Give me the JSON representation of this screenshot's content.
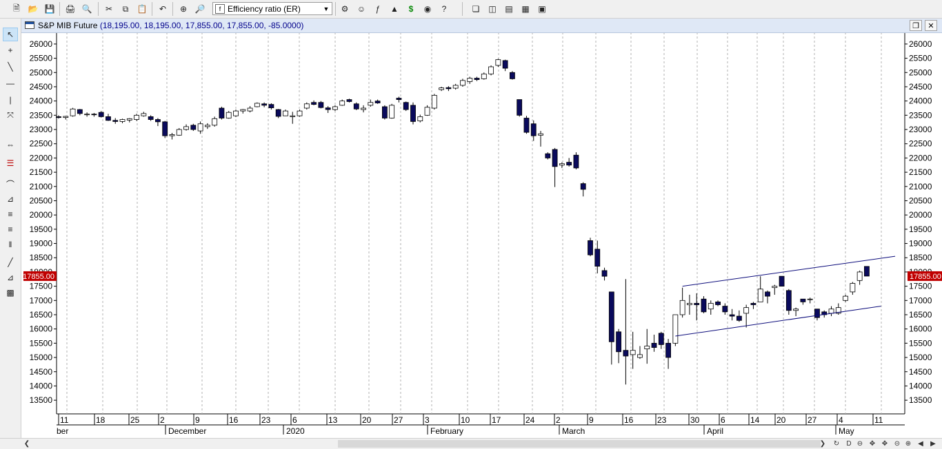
{
  "toolbar": {
    "indicator_dropdown": "Efficiency ratio (ER)"
  },
  "window": {
    "symbol": "S&P MIB Future",
    "ohlc": "(18,195.00, 18,195.00, 17,855.00, 17,855.00, -85.0000)"
  },
  "price_axis": {
    "labels": [
      "26000",
      "25500",
      "25000",
      "24500",
      "24000",
      "23500",
      "23000",
      "22500",
      "22000",
      "21500",
      "21000",
      "20500",
      "20000",
      "19500",
      "19000",
      "18500",
      "18000",
      "17500",
      "17000",
      "16500",
      "16000",
      "15500",
      "15000",
      "14500",
      "14000",
      "13500"
    ],
    "last_price_label": "17855.00",
    "last_price_color": "#c00000"
  },
  "time_axis": {
    "day_labels": [
      "11",
      "18",
      "25",
      "2",
      "9",
      "16",
      "23",
      "6",
      "13",
      "20",
      "27",
      "3",
      "10",
      "17",
      "24",
      "2",
      "9",
      "16",
      "23",
      "30",
      "6",
      "14",
      "20",
      "27",
      "4",
      "11"
    ],
    "month_labels": [
      "ber",
      "December",
      "2020",
      "February",
      "March",
      "April",
      "May"
    ]
  },
  "colors": {
    "bear_candle": "#0a0a5c",
    "bull_candle": "#ffffff",
    "channel_line": "#0a0a7a",
    "grid": "#b0b0b0"
  },
  "chart_data": {
    "type": "candlestick",
    "ylim": [
      13000,
      26500
    ],
    "candles": [
      [
        23450,
        23500,
        23380,
        23420
      ],
      [
        23420,
        23480,
        23350,
        23460
      ],
      [
        23480,
        23760,
        23450,
        23720
      ],
      [
        23700,
        23720,
        23500,
        23560
      ],
      [
        23520,
        23600,
        23450,
        23540
      ],
      [
        23540,
        23580,
        23450,
        23520
      ],
      [
        23600,
        23650,
        23420,
        23450
      ],
      [
        23450,
        23550,
        23300,
        23320
      ],
      [
        23320,
        23400,
        23200,
        23280
      ],
      [
        23280,
        23380,
        23220,
        23350
      ],
      [
        23330,
        23400,
        23250,
        23380
      ],
      [
        23350,
        23550,
        23300,
        23500
      ],
      [
        23480,
        23620,
        23450,
        23560
      ],
      [
        23450,
        23500,
        23300,
        23350
      ],
      [
        23350,
        23400,
        23120,
        23270
      ],
      [
        23270,
        23300,
        22700,
        22780
      ],
      [
        22780,
        22880,
        22650,
        22820
      ],
      [
        22800,
        23050,
        22780,
        23000
      ],
      [
        23000,
        23180,
        22960,
        23100
      ],
      [
        23150,
        23200,
        22950,
        23000
      ],
      [
        22950,
        23280,
        22850,
        23200
      ],
      [
        23100,
        23220,
        23020,
        23150
      ],
      [
        23150,
        23450,
        23100,
        23380
      ],
      [
        23750,
        23800,
        23350,
        23400
      ],
      [
        23400,
        23650,
        23380,
        23600
      ],
      [
        23480,
        23700,
        23440,
        23650
      ],
      [
        23650,
        23720,
        23560,
        23700
      ],
      [
        23650,
        23820,
        23600,
        23750
      ],
      [
        23800,
        23950,
        23780,
        23920
      ],
      [
        23900,
        23950,
        23780,
        23850
      ],
      [
        23880,
        23920,
        23700,
        23760
      ],
      [
        23700,
        23720,
        23400,
        23460
      ],
      [
        23480,
        23700,
        23470,
        23650
      ],
      [
        23450,
        23620,
        23200,
        23480
      ],
      [
        23480,
        23700,
        23450,
        23650
      ],
      [
        23750,
        23950,
        23700,
        23900
      ],
      [
        23950,
        24020,
        23850,
        23880
      ],
      [
        23950,
        24000,
        23740,
        23770
      ],
      [
        23760,
        23820,
        23580,
        23700
      ],
      [
        23700,
        23850,
        23650,
        23800
      ],
      [
        23850,
        24050,
        23830,
        24000
      ],
      [
        24050,
        24080,
        23950,
        23980
      ],
      [
        23900,
        23950,
        23680,
        23720
      ],
      [
        23700,
        23850,
        23600,
        23750
      ],
      [
        23850,
        24050,
        23800,
        23950
      ],
      [
        24000,
        24050,
        23900,
        23930
      ],
      [
        23800,
        23850,
        23350,
        23400
      ],
      [
        23400,
        23900,
        23380,
        23850
      ],
      [
        24100,
        24150,
        23950,
        24050
      ],
      [
        23950,
        23980,
        23650,
        23700
      ],
      [
        23850,
        23950,
        23180,
        23280
      ],
      [
        23300,
        23520,
        23250,
        23450
      ],
      [
        23500,
        23850,
        23480,
        23780
      ],
      [
        23750,
        24250,
        23700,
        24200
      ],
      [
        24400,
        24500,
        24350,
        24460
      ],
      [
        24470,
        24520,
        24350,
        24430
      ],
      [
        24450,
        24600,
        24400,
        24550
      ],
      [
        24550,
        24780,
        24500,
        24720
      ],
      [
        24680,
        24850,
        24600,
        24800
      ],
      [
        24800,
        24850,
        24700,
        24750
      ],
      [
        24780,
        25000,
        24750,
        24950
      ],
      [
        24950,
        25250,
        24900,
        25200
      ],
      [
        25250,
        25480,
        25200,
        25450
      ],
      [
        25420,
        25450,
        25050,
        25150
      ],
      [
        25000,
        25050,
        24750,
        24780
      ],
      [
        24050,
        24050,
        23450,
        23500
      ],
      [
        23400,
        23480,
        22850,
        22900
      ],
      [
        23200,
        23320,
        22600,
        22780
      ],
      [
        22800,
        22950,
        22400,
        22850
      ],
      [
        22150,
        22200,
        21950,
        22000
      ],
      [
        22300,
        22350,
        20980,
        21700
      ],
      [
        21750,
        21850,
        21650,
        21800
      ],
      [
        21850,
        22000,
        21700,
        21750
      ],
      [
        22100,
        22200,
        21600,
        21650
      ],
      [
        21100,
        21150,
        20650,
        20900
      ],
      [
        19100,
        19200,
        18550,
        18600
      ],
      [
        18800,
        19100,
        17950,
        18200
      ],
      [
        18050,
        18150,
        17700,
        17850
      ],
      [
        17300,
        17300,
        14750,
        15550
      ],
      [
        15900,
        16000,
        14800,
        15200
      ],
      [
        15250,
        17750,
        14050,
        15050
      ],
      [
        15100,
        15900,
        14600,
        15250
      ],
      [
        15000,
        15400,
        14950,
        15100
      ],
      [
        15300,
        16000,
        14780,
        15400
      ],
      [
        15500,
        15800,
        15200,
        15350
      ],
      [
        15850,
        15900,
        15300,
        15450
      ],
      [
        15500,
        15650,
        14600,
        15000
      ],
      [
        15500,
        16500,
        15400,
        16500
      ],
      [
        16500,
        17450,
        16400,
        17000
      ],
      [
        16850,
        17200,
        16500,
        16900
      ],
      [
        16900,
        17250,
        16300,
        16850
      ],
      [
        17050,
        17150,
        16550,
        16600
      ],
      [
        16700,
        17000,
        16500,
        16900
      ],
      [
        16950,
        17000,
        16800,
        16850
      ],
      [
        16800,
        16900,
        16500,
        16600
      ],
      [
        16500,
        16700,
        16300,
        16450
      ],
      [
        16450,
        16650,
        16250,
        16300
      ],
      [
        16550,
        16850,
        16050,
        16750
      ],
      [
        16900,
        16950,
        16700,
        16850
      ],
      [
        16950,
        17850,
        16950,
        17400
      ],
      [
        17300,
        17350,
        16900,
        17150
      ],
      [
        17450,
        17550,
        17200,
        17500
      ],
      [
        17850,
        17850,
        17500,
        17500
      ],
      [
        17350,
        17400,
        16500,
        16650
      ],
      [
        16650,
        16750,
        16450,
        16700
      ],
      [
        17050,
        17050,
        16850,
        16950
      ],
      [
        17050,
        17100,
        16900,
        17050
      ],
      [
        16700,
        16700,
        16300,
        16400
      ],
      [
        16600,
        16650,
        16400,
        16500
      ],
      [
        16550,
        16800,
        16450,
        16700
      ],
      [
        16550,
        16900,
        16500,
        16750
      ],
      [
        17000,
        17200,
        16950,
        17150
      ],
      [
        17300,
        17650,
        17200,
        17600
      ],
      [
        17700,
        18050,
        17550,
        18000
      ],
      [
        18195,
        18195,
        17855,
        17855
      ]
    ],
    "upper_channel": [
      [
        17500,
        18550
      ]
    ],
    "lower_channel": [
      [
        15750,
        16800
      ]
    ]
  }
}
